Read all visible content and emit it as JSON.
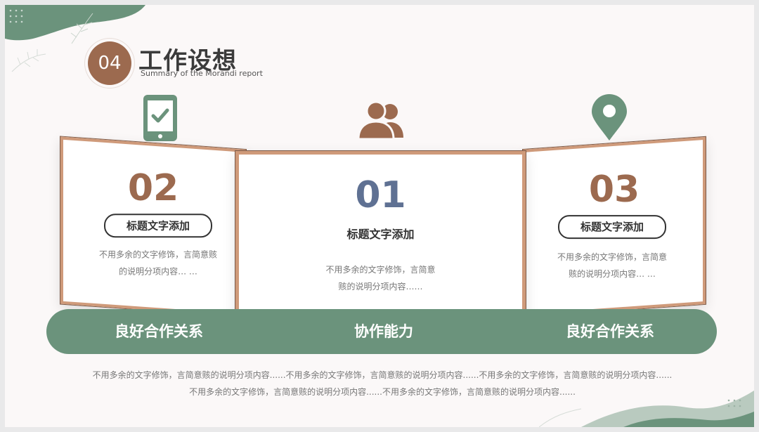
{
  "header": {
    "section_number": "04",
    "title": "工作设想",
    "subtitle": "Summary of the Morandi report"
  },
  "colors": {
    "green": "#6b937c",
    "brown": "#9c6a4f",
    "slate": "#5f7193",
    "panel_border": "#cf9a7a"
  },
  "icons": {
    "left": "tablet-check-icon",
    "center": "users-icon",
    "right": "location-pin-icon"
  },
  "panels": {
    "left": {
      "number": "02",
      "heading": "标题文字添加",
      "desc_line1": "不用多余的文字修饰，言简意赅",
      "desc_line2": "的说明分项内容… …"
    },
    "center": {
      "number": "01",
      "heading": "标题文字添加",
      "desc_line1": "不用多余的文字修饰，言简意",
      "desc_line2": "赅的说明分项内容……"
    },
    "right": {
      "number": "03",
      "heading": "标题文字添加",
      "desc_line1": "不用多余的文字修饰，言简意",
      "desc_line2": "赅的说明分项内容… …"
    }
  },
  "band": {
    "left": "良好合作关系",
    "center": "协作能力",
    "right": "良好合作关系"
  },
  "footer": {
    "line1": "不用多余的文字修饰，言简意赅的说明分项内容......不用多余的文字修饰，言简意赅的说明分项内容......不用多余的文字修饰，言简意赅的说明分项内容......",
    "line2": "不用多余的文字修饰，言简意赅的说明分项内容......不用多余的文字修饰，言简意赅的说明分项内容......"
  }
}
